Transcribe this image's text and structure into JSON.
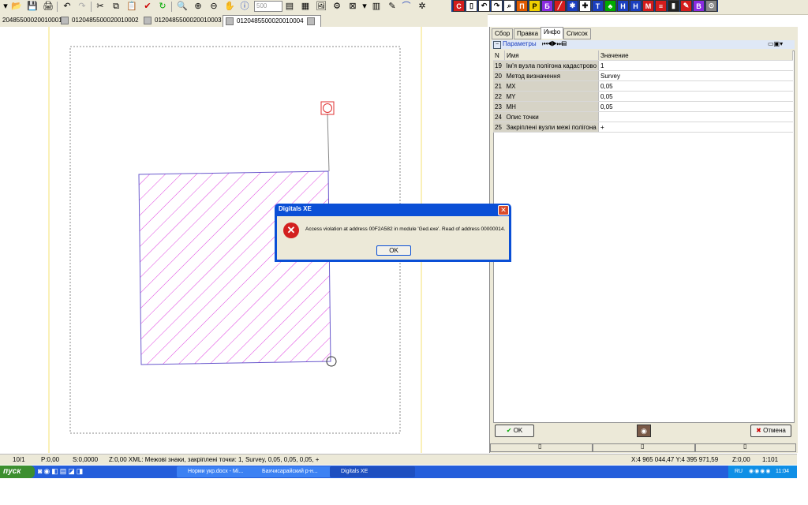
{
  "toolbar": {
    "zoom_value": "500",
    "colored_labels": [
      "С",
      "П",
      "Б",
      "М"
    ]
  },
  "doc_tabs": [
    {
      "label": "20485500020010001"
    },
    {
      "label": "0120485500020010002"
    },
    {
      "label": "0120485500020010003"
    },
    {
      "label": "0120485500020010004"
    }
  ],
  "panel": {
    "tabs": [
      {
        "label": "Сбор"
      },
      {
        "label": "Правка"
      },
      {
        "label": "Инфо"
      },
      {
        "label": "Список"
      }
    ],
    "section_label": "Параметры",
    "columns": {
      "n": "N",
      "name": "Имя",
      "value": "Значение"
    },
    "rows": [
      {
        "n": "19",
        "name": "Ім'я вузла полігона кадастрово",
        "value": "1"
      },
      {
        "n": "20",
        "name": "Метод визначення",
        "value": "Survey"
      },
      {
        "n": "21",
        "name": "MX",
        "value": "0,05"
      },
      {
        "n": "22",
        "name": "MY",
        "value": "0,05"
      },
      {
        "n": "23",
        "name": "MH",
        "value": "0,05"
      },
      {
        "n": "24",
        "name": "Опис точки",
        "value": ""
      },
      {
        "n": "25",
        "name": "Закріплені вузли межі полігона",
        "value": "+"
      }
    ],
    "ok_label": "OK",
    "cancel_label": "Отмена"
  },
  "dialog": {
    "title": "Digitals XE",
    "message": "Access violation at address 00F2A582 in module 'Ged.exe'. Read of address 00000014.",
    "ok_label": "OK"
  },
  "status": {
    "page": "10/1",
    "p": "P:0,00",
    "s": "S:0,0000",
    "info": "Z:0,00 XML: Межові знаки, закріплені точки: 1, Survey, 0,05, 0,05, 0,05, +",
    "coords": "X:4 965 044,47 Y:4 395 971,59",
    "z": "Z:0,00",
    "scale": "1:101"
  },
  "taskbar": {
    "start_label": "пуск",
    "tasks": [
      {
        "label": "Норми укр.docx - Mi..."
      },
      {
        "label": "Бахчисарайский р-н..."
      },
      {
        "label": "Digitals XE"
      }
    ],
    "lang": "RU",
    "clock": "11:04"
  },
  "colors": {
    "hatch": "#e040e0",
    "xp_blue": "#0a4fd6",
    "error_red": "#d3201f"
  }
}
